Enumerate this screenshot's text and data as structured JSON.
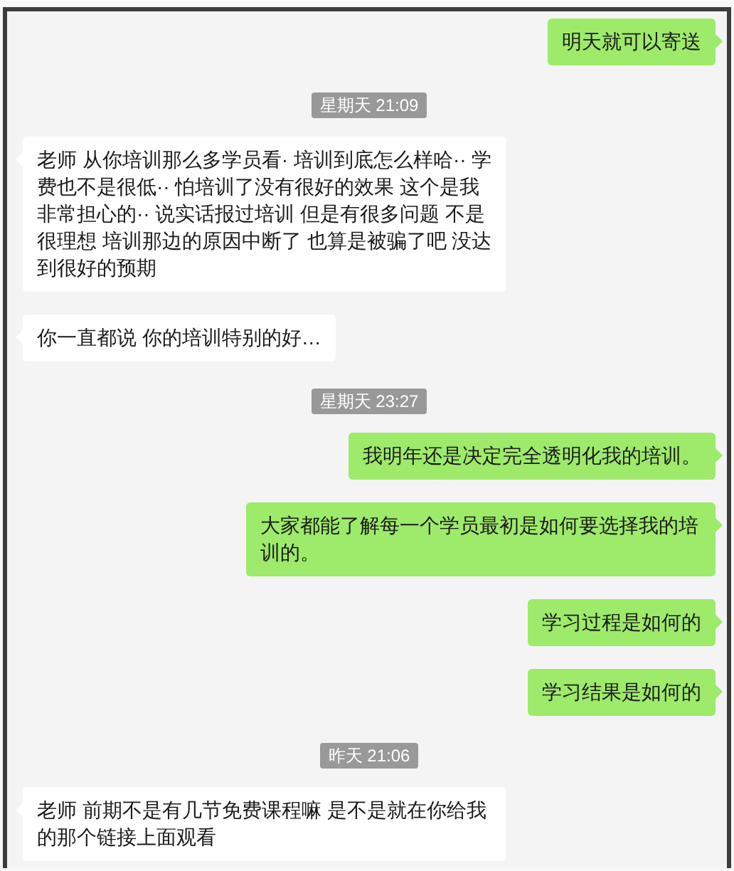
{
  "messages": [
    {
      "kind": "message",
      "outgoing": true,
      "text": "明天就可以寄送"
    },
    {
      "kind": "timestamp",
      "text": "星期天 21:09"
    },
    {
      "kind": "message",
      "outgoing": false,
      "text": "老师  从你培训那么多学员看· 培训到底怎么样哈·· 学费也不是很低·· 怕培训了没有很好的效果  这个是我非常担心的··   说实话报过培训 但是有很多问题 不是很理想 培训那边的原因中断了  也算是被骗了吧 没达到很好的预期"
    },
    {
      "kind": "message",
      "outgoing": false,
      "text": "你一直都说 你的培训特别的好…"
    },
    {
      "kind": "timestamp",
      "text": "星期天 23:27"
    },
    {
      "kind": "message",
      "outgoing": true,
      "text": "我明年还是决定完全透明化我的培训。"
    },
    {
      "kind": "message",
      "outgoing": true,
      "text": "大家都能了解每一个学员最初是如何要选择我的培训的。"
    },
    {
      "kind": "message",
      "outgoing": true,
      "text": "学习过程是如何的"
    },
    {
      "kind": "message",
      "outgoing": true,
      "text": "学习结果是如何的"
    },
    {
      "kind": "timestamp",
      "text": "昨天 21:06"
    },
    {
      "kind": "message",
      "outgoing": false,
      "text": "老师  前期不是有几节免费课程嘛  是不是就在你给我的那个链接上面观看"
    }
  ]
}
